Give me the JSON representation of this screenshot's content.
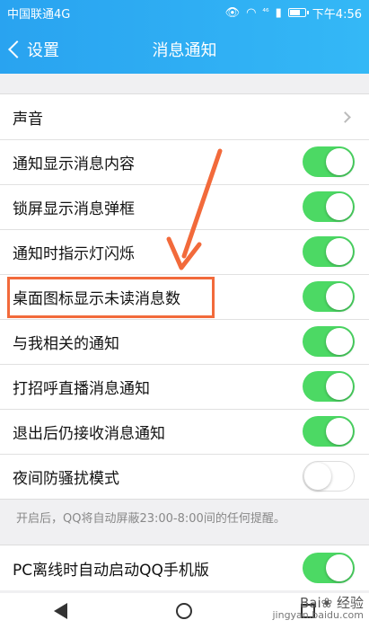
{
  "status_bar": {
    "carrier": "中国联通4G",
    "network": "⁴⁶",
    "time": "下午4:56",
    "battery_level": 0.7
  },
  "nav": {
    "back_label": "设置",
    "title": "消息通知"
  },
  "settings": [
    {
      "label": "声音",
      "type": "link"
    },
    {
      "label": "通知显示消息内容",
      "type": "toggle",
      "on": true
    },
    {
      "label": "锁屏显示消息弹框",
      "type": "toggle",
      "on": true
    },
    {
      "label": "通知时指示灯闪烁",
      "type": "toggle",
      "on": true
    },
    {
      "label": "桌面图标显示未读消息数",
      "type": "toggle",
      "on": true
    },
    {
      "label": "与我相关的通知",
      "type": "toggle",
      "on": true
    },
    {
      "label": "打招呼直播消息通知",
      "type": "toggle",
      "on": true
    },
    {
      "label": "退出后仍接收消息通知",
      "type": "toggle",
      "on": true
    },
    {
      "label": "夜间防骚扰模式",
      "type": "toggle",
      "on": false
    }
  ],
  "hint": "开启后，QQ将自动屏蔽23:00-8:00间的任何提醒。",
  "settings2": [
    {
      "label": "PC离线时自动启动QQ手机版",
      "type": "toggle",
      "on": true
    }
  ],
  "watermark": {
    "brand": "Bai❀ 经验",
    "url": "jingyan.baidu.com"
  },
  "colors": {
    "header": "#2fb0f4",
    "toggle_on": "#4cd964",
    "annotation": "#f26a3b"
  }
}
